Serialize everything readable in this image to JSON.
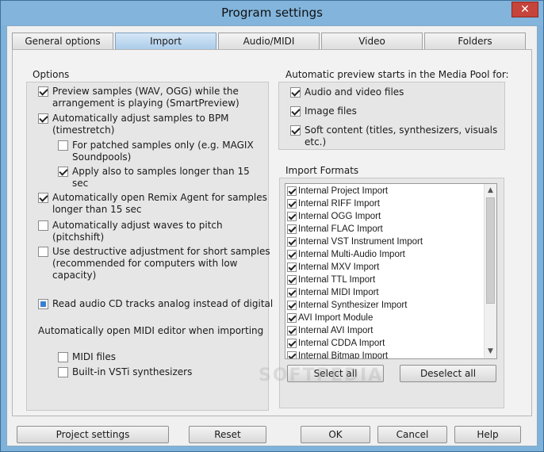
{
  "window": {
    "title": "Program settings",
    "close_glyph": "✕"
  },
  "tabs": [
    "General options",
    "Import",
    "Audio/MIDI",
    "Video",
    "Folders"
  ],
  "options": {
    "title": "Options",
    "items": [
      {
        "label": "Preview samples (WAV, OGG) while the",
        "label2": "arrangement is playing (SmartPreview)",
        "state": "checked"
      },
      {
        "label": "Automatically adjust samples to BPM",
        "label2": "(timestretch)",
        "state": "checked"
      },
      {
        "label": "For patched samples only (e.g. MAGIX",
        "label2": "Soundpools)",
        "state": "unchecked"
      },
      {
        "label": "Apply also to samples longer than 15",
        "label2": "sec",
        "state": "checked"
      },
      {
        "label": "Automatically open Remix Agent for samples",
        "label2": "longer than 15 sec",
        "state": "checked"
      },
      {
        "label": "Automatically adjust waves to pitch",
        "label2": "(pitchshift)",
        "state": "unchecked"
      },
      {
        "label": "Use destructive adjustment for short samples",
        "label2": "(recommended for computers with low",
        "label3": "capacity)",
        "state": "unchecked"
      },
      {
        "label": "Read audio CD tracks analog instead of digital",
        "state": "indeterminate"
      }
    ],
    "midi_heading": "Automatically open MIDI editor when importing",
    "midi_items": [
      {
        "label": "MIDI files",
        "state": "unchecked"
      },
      {
        "label": "Built-in VSTi synthesizers",
        "state": "unchecked"
      }
    ]
  },
  "preview": {
    "title": "Automatic preview starts in the Media Pool for:",
    "items": [
      {
        "label": "Audio and video files",
        "state": "checked"
      },
      {
        "label": "Image files",
        "state": "checked"
      },
      {
        "label": "Soft content (titles, synthesizers, visuals",
        "label2": "etc.)",
        "state": "checked"
      }
    ]
  },
  "import_formats": {
    "title": "Import Formats",
    "items": [
      "Internal Project Import",
      "Internal RIFF Import",
      "Internal OGG Import",
      "Internal FLAC Import",
      "Internal VST Instrument Import",
      "Internal Multi-Audio Import",
      "Internal MXV Import",
      "Internal TTL Import",
      "Internal MIDI Import",
      "Internal Synthesizer Import",
      "AVI Import Module",
      "Internal AVI Import",
      "Internal CDDA Import",
      "Internal Bitmap Import"
    ],
    "select_all": "Select all",
    "deselect_all": "Deselect all"
  },
  "footer": {
    "project_settings": "Project settings",
    "reset": "Reset",
    "ok": "OK",
    "cancel": "Cancel",
    "help": "Help"
  },
  "watermark": "SOFTPEDIA"
}
